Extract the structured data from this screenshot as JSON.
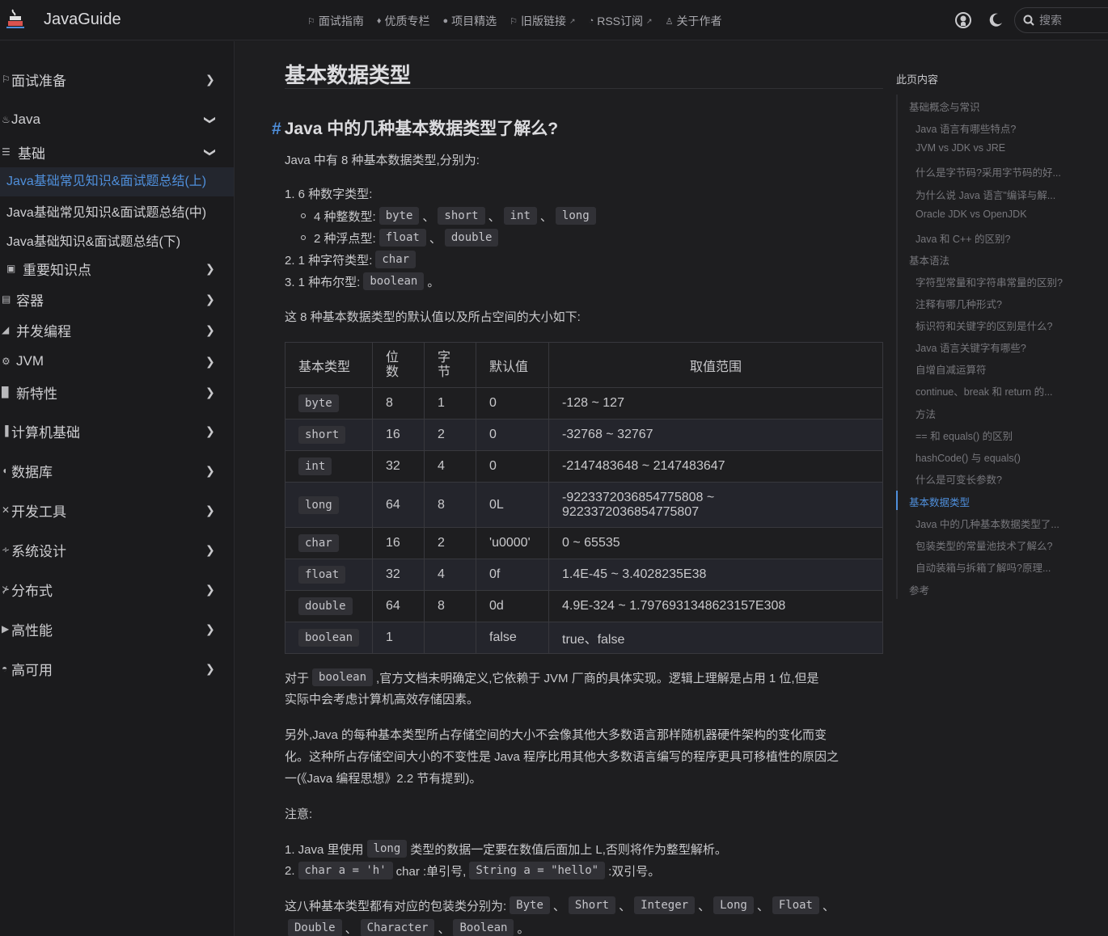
{
  "navbar": {
    "brand": "JavaGuide",
    "links": [
      {
        "label": "面试指南",
        "icon": "signpost-icon"
      },
      {
        "label": "优质专栏",
        "icon": "thumbs-up-icon"
      },
      {
        "label": "项目精选",
        "icon": "github-icon"
      },
      {
        "label": "旧版链接",
        "icon": "signpost-icon",
        "external": true
      },
      {
        "label": "RSS订阅",
        "icon": "rss-icon",
        "external": true
      },
      {
        "label": "关于作者",
        "icon": "person-icon"
      }
    ],
    "search_placeholder": "搜索"
  },
  "sidebar": {
    "items": [
      {
        "label": "面试准备",
        "state": "collapsed"
      },
      {
        "label": "Java",
        "state": "expanded"
      },
      {
        "label": "基础",
        "state": "expanded"
      },
      {
        "label": "Java基础常见知识&面试题总结(上)",
        "sub": true,
        "active": true
      },
      {
        "label": "Java基础常见知识&面试题总结(中)",
        "sub": true
      },
      {
        "label": "Java基础知识&面试题总结(下)",
        "sub": true
      },
      {
        "label": "重要知识点",
        "state": "collapsed"
      },
      {
        "label": "容器",
        "state": "collapsed"
      },
      {
        "label": "并发编程",
        "state": "collapsed"
      },
      {
        "label": "JVM",
        "state": "collapsed"
      },
      {
        "label": "新特性",
        "state": "collapsed"
      },
      {
        "label": "计算机基础",
        "state": "collapsed"
      },
      {
        "label": "数据库",
        "state": "collapsed"
      },
      {
        "label": "开发工具",
        "state": "collapsed"
      },
      {
        "label": "系统设计",
        "state": "collapsed"
      },
      {
        "label": "分布式",
        "state": "collapsed"
      },
      {
        "label": "高性能",
        "state": "collapsed"
      },
      {
        "label": "高可用",
        "state": "collapsed"
      }
    ]
  },
  "main": {
    "title": "基本数据类型",
    "h2_anchor": "#",
    "h2": "Java 中的几种基本数据类型了解么?",
    "intro": "Java 中有 8 种基本数据类型,分别为:",
    "list": {
      "l1_prefix": "1. 6 种数字类型:",
      "l1a_prefix": "4 种整数型:",
      "l1a_codes": [
        "byte",
        "short",
        "int",
        "long"
      ],
      "l1b_prefix": "2 种浮点型:",
      "l1b_codes": [
        "float",
        "double"
      ],
      "l2_prefix": "2. 1 种字符类型:",
      "l2_code": "char",
      "l3_prefix": "3. 1 种布尔型:",
      "l3_code": "boolean",
      "sep": "、",
      "end": "。"
    },
    "table_intro": "这 8 种基本数据类型的默认值以及所占空间的大小如下:",
    "table": {
      "headers": [
        "基本类型",
        "位数",
        "字节",
        "默认值",
        "取值范围"
      ],
      "headers_split": {
        "bits": [
          "位",
          "数"
        ],
        "bytes": [
          "字",
          "节"
        ]
      },
      "rows": [
        {
          "type": "byte",
          "bits": "8",
          "bytes": "1",
          "default": "0",
          "range": "-128 ~ 127"
        },
        {
          "type": "short",
          "bits": "16",
          "bytes": "2",
          "default": "0",
          "range": "-32768 ~ 32767"
        },
        {
          "type": "int",
          "bits": "32",
          "bytes": "4",
          "default": "0",
          "range": "-2147483648 ~ 2147483647"
        },
        {
          "type": "long",
          "bits": "64",
          "bytes": "8",
          "default": "0L",
          "range": "-9223372036854775808 ~",
          "range2": "9223372036854775807"
        },
        {
          "type": "char",
          "bits": "16",
          "bytes": "2",
          "default": "'u0000'",
          "range": "0 ~ 65535"
        },
        {
          "type": "float",
          "bits": "32",
          "bytes": "4",
          "default": "0f",
          "range": "1.4E-45 ~ 3.4028235E38"
        },
        {
          "type": "double",
          "bits": "64",
          "bytes": "8",
          "default": "0d",
          "range": "4.9E-324 ~ 1.7976931348623157E308"
        },
        {
          "type": "boolean",
          "bits": "1",
          "bytes": "",
          "default": "false",
          "range": "true、false"
        }
      ]
    },
    "p_boolean_pre": "对于",
    "p_boolean_code": "boolean",
    "p_boolean_line1": ",官方文档未明确定义,它依赖于 JVM 厂商的具体实现。逻辑上理解是占用 1 位,但是",
    "p_boolean_line2": "实际中会考虑计算机高效存储因素。",
    "p_portable_1": "另外,Java 的每种基本类型所占存储空间的大小不会像其他大多数语言那样随机器硬件架构的变化而变",
    "p_portable_2": "化。这种所占存储空间大小的不变性是 Java 程序比用其他大多数语言编写的程序更具可移植性的原因之",
    "p_portable_3": "一(《Java 编程思想》2.2 节有提到)。",
    "note_label": "注意:",
    "note1_pre": "1. Java 里使用",
    "note1_code": "long",
    "note1_post": "类型的数据一定要在数值后面加上 L,否则将作为整型解析。",
    "note2_pre": "2.",
    "note2_code1": "char a = 'h'",
    "note2_mid": "char :单引号,",
    "note2_code2": "String a = \"hello\"",
    "note2_post": ":双引号。",
    "wrapper_intro": "这八种基本类型都有对应的包装类分别为:",
    "wrapper_codes_line1": [
      "Byte",
      "Short",
      "Integer",
      "Long",
      "Float"
    ],
    "wrapper_codes_line2": [
      "Double",
      "Character",
      "Boolean"
    ]
  },
  "toc": {
    "title": "此页内容",
    "items": [
      {
        "label": "基础概念与常识",
        "level": 1
      },
      {
        "label": "Java 语言有哪些特点?",
        "level": 2
      },
      {
        "label": "JVM vs JDK vs JRE",
        "level": 2
      },
      {
        "label": "什么是字节码?采用字节码的好...",
        "level": 2
      },
      {
        "label": "为什么说 Java 语言\"编译与解...",
        "level": 2
      },
      {
        "label": "Oracle JDK vs OpenJDK",
        "level": 2
      },
      {
        "label": "Java 和 C++ 的区别?",
        "level": 2
      },
      {
        "label": "基本语法",
        "level": 1
      },
      {
        "label": "字符型常量和字符串常量的区别?",
        "level": 2
      },
      {
        "label": "注释有哪几种形式?",
        "level": 2
      },
      {
        "label": "标识符和关键字的区别是什么?",
        "level": 2
      },
      {
        "label": "Java 语言关键字有哪些?",
        "level": 2
      },
      {
        "label": "自增自减运算符",
        "level": 2
      },
      {
        "label": "continue、break 和 return 的...",
        "level": 2
      },
      {
        "label": "方法",
        "level": 2
      },
      {
        "label": "== 和 equals() 的区别",
        "level": 2
      },
      {
        "label": "hashCode() 与 equals()",
        "level": 2
      },
      {
        "label": "什么是可变长参数?",
        "level": 2
      },
      {
        "label": "基本数据类型",
        "level": 1,
        "active": true
      },
      {
        "label": "Java 中的几种基本数据类型了...",
        "level": 2
      },
      {
        "label": "包装类型的常量池技术了解么?",
        "level": 2
      },
      {
        "label": "自动装箱与拆箱了解吗?原理...",
        "level": 2
      },
      {
        "label": "参考",
        "level": 1
      }
    ]
  },
  "colors": {
    "accent": "#4f8fdb",
    "background": "#1e1e20",
    "text": "#c9c9cc"
  }
}
